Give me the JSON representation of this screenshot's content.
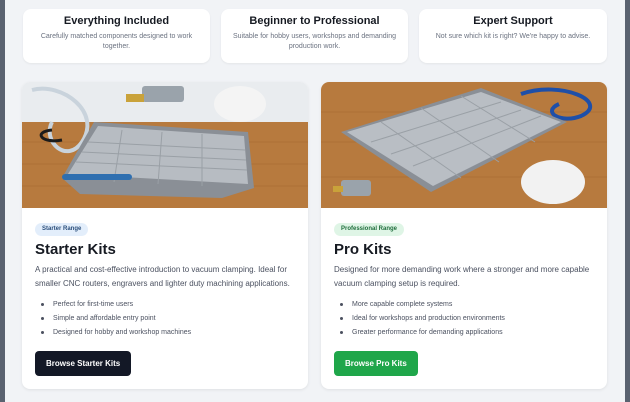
{
  "features": [
    {
      "title": "Everything Included",
      "desc": "Carefully matched components designed to work together."
    },
    {
      "title": "Beginner to Professional",
      "desc": "Suitable for hobby users, workshops and demanding production work."
    },
    {
      "title": "Expert Support",
      "desc": "Not sure which kit is right? We're happy to advise."
    }
  ],
  "cards": {
    "starter": {
      "badge": "Starter Range",
      "title": "Starter Kits",
      "desc": "A practical and cost-effective introduction to vacuum clamping. Ideal for smaller CNC routers, engravers and lighter duty machining applications.",
      "bullets": [
        "Perfect for first-time users",
        "Simple and affordable entry point",
        "Designed for hobby and workshop machines"
      ],
      "button": "Browse Starter Kits"
    },
    "pro": {
      "badge": "Professional Range",
      "title": "Pro Kits",
      "desc": "Designed for more demanding work where a stronger and more capable vacuum clamping setup is required.",
      "bullets": [
        "More capable complete systems",
        "Ideal for workshops and production environments",
        "Greater performance for demanding applications"
      ],
      "button": "Browse Pro Kits"
    }
  },
  "colors": {
    "dark_button": "#131826",
    "green_button": "#1fa64a",
    "badge_blue": "#e3eefb",
    "badge_green": "#dff5e6"
  }
}
